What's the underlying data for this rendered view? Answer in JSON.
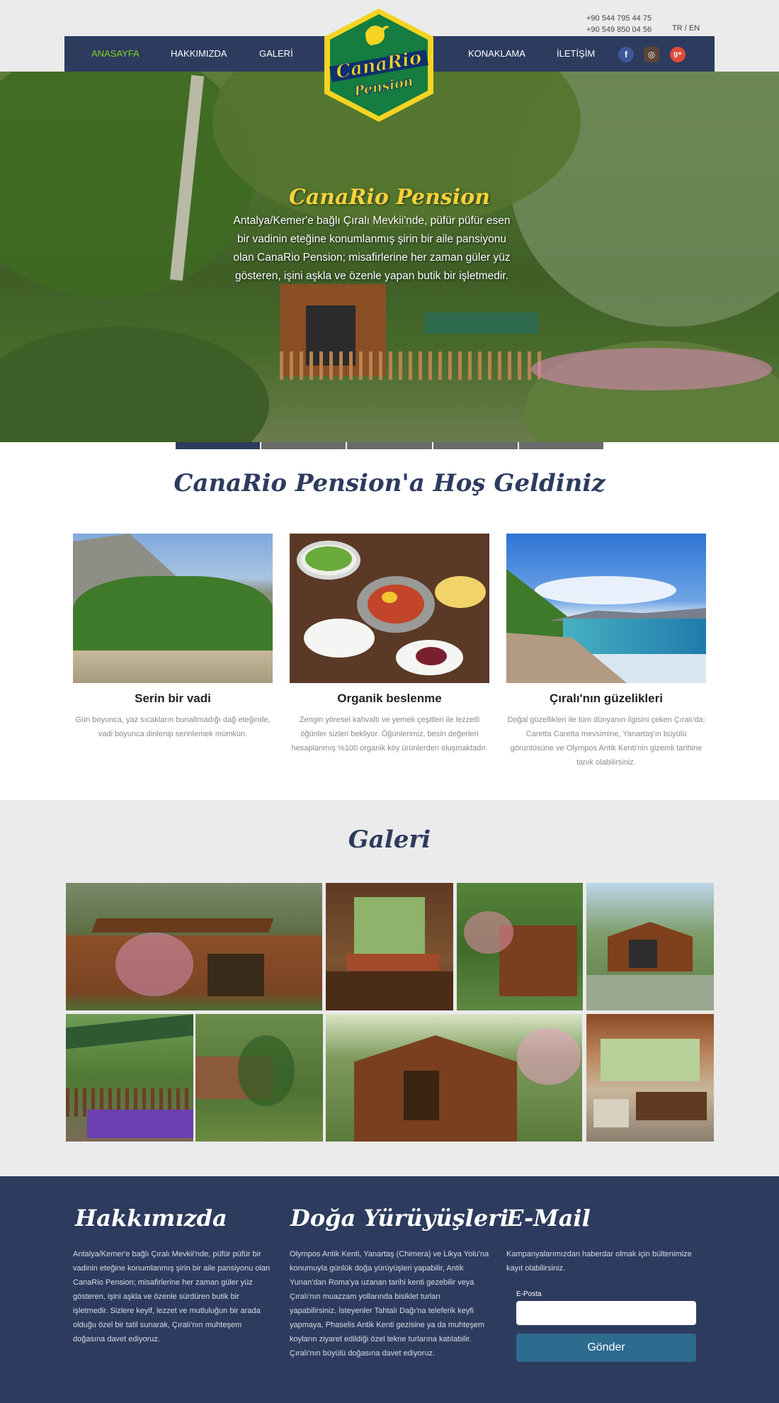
{
  "header": {
    "phone_1": "+90 544 795 44 75",
    "phone_2": "+90 549 850 04 56",
    "language": "TR / EN",
    "nav": [
      "ANASAYFA",
      "HAKKIMIZDA",
      "GALERİ",
      "KONAKLAMA",
      "İLETİŞİM"
    ],
    "active_nav": "ANASAYFA",
    "logo": {
      "line_1": "CanaRio",
      "line_2": "Pension"
    },
    "social_icons": [
      "facebook-icon",
      "instagram-icon",
      "google-plus-icon"
    ]
  },
  "hero": {
    "title": "CanaRio Pension",
    "text": "Antalya/Kemer'e bağlı Çıralı Mevkii'nde, püfür püfür esen bir vadinin eteğine konumlanmış şirin bir aile pansiyonu olan CanaRio Pension; misafirlerine her zaman güler yüz gösteren, işini aşkla ve özenle yapan butik bir işletmedir.",
    "slide_count": 5,
    "active_slide": 1
  },
  "welcome": {
    "title": "CanaRio Pension'a Hoş Geldiniz",
    "features": [
      {
        "title": "Serin bir vadi",
        "text": "Gün boyunca, yaz sıcakların bunaltmadığı dağ eteğinde, vadi boyunca dinlenip serinlemek mümkün."
      },
      {
        "title": "Organik beslenme",
        "text": "Zengin yöresel kahvaltı ve yemek çeşitleri ile lezzetli öğünler sizleri bekliyor. Öğünlerimiz, besin değerleri hesaplanmış %100 organik köy ürünlerden oluşmaktadır."
      },
      {
        "title": "Çıralı'nın güzelikleri",
        "text": "Doğal güzellikleri ile tüm dünyanın ilgisini çeken Çıralı'da; Caretta Caretta mevsimine, Yanartaş'ın büyülü görüntüsüne ve Olympos Antik Kenti'nin gizemli tarihine tanık olabilirsiniz."
      }
    ]
  },
  "gallery": {
    "title": "Galeri",
    "photo_count": 8
  },
  "footer": {
    "about": {
      "title": "Hakkımızda",
      "text": "Antalya/Kemer'e bağlı Çıralı Mevkii'nde, püfür püfür bir vadinin eteğine konumlanmış şirin bir aile pansiyonu olan CanaRio Pension; misafirlerine her zaman güler yüz gösteren, işini aşkla ve özenle sürdüren butik bir işletmedir. Sizlere keyif, lezzet ve mutluluğun bir arada olduğu özel bir tatil sunarak, Çıralı'nın muhteşem doğasına davet ediyoruz."
    },
    "hikes": {
      "title": "Doğa Yürüyüşleri",
      "text": "Olympos Antik Kenti, Yanartaş (Chimera) ve Likya Yolu'na konumuyla günlük doğa yürüyüşleri yapabilir, Antik Yunan'dan Roma'ya uzanan tarihi kenti gezebilir veya Çıralı'nın muazzam yollarında bisiklet turları yapabilirsiniz. İsteyenler Tahtalı Dağı'na teleferik keyfi yapmaya, Phaselis Antik Kenti gezisine ya da muhteşem koyların ziyaret edildiği özel tekne turlarına katılabilir. Çıralı'nın büyülü doğasına davet ediyoruz."
    },
    "email": {
      "title": "E-Mail",
      "text": "Kampanyalarımızdan haberdar olmak için bültenimize kayıt olabilirsiniz.",
      "label": "E-Posta",
      "value": "",
      "button": "Gönder"
    }
  }
}
